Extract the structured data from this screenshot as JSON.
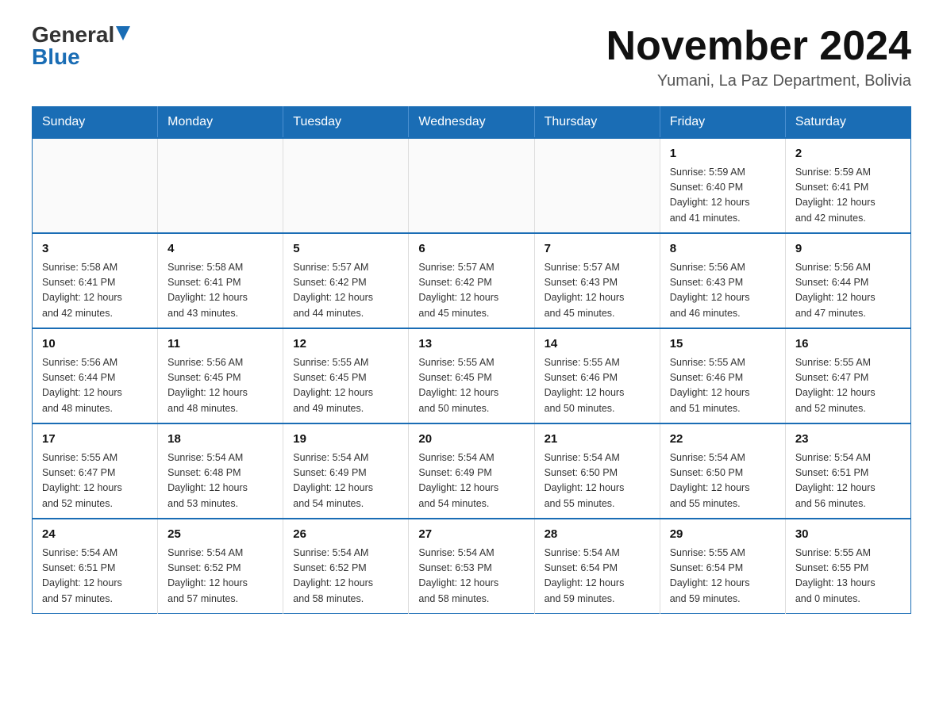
{
  "header": {
    "logo_general": "General",
    "logo_blue": "Blue",
    "month_title": "November 2024",
    "location": "Yumani, La Paz Department, Bolivia"
  },
  "weekdays": [
    "Sunday",
    "Monday",
    "Tuesday",
    "Wednesday",
    "Thursday",
    "Friday",
    "Saturday"
  ],
  "weeks": [
    [
      {
        "day": "",
        "info": ""
      },
      {
        "day": "",
        "info": ""
      },
      {
        "day": "",
        "info": ""
      },
      {
        "day": "",
        "info": ""
      },
      {
        "day": "",
        "info": ""
      },
      {
        "day": "1",
        "info": "Sunrise: 5:59 AM\nSunset: 6:40 PM\nDaylight: 12 hours\nand 41 minutes."
      },
      {
        "day": "2",
        "info": "Sunrise: 5:59 AM\nSunset: 6:41 PM\nDaylight: 12 hours\nand 42 minutes."
      }
    ],
    [
      {
        "day": "3",
        "info": "Sunrise: 5:58 AM\nSunset: 6:41 PM\nDaylight: 12 hours\nand 42 minutes."
      },
      {
        "day": "4",
        "info": "Sunrise: 5:58 AM\nSunset: 6:41 PM\nDaylight: 12 hours\nand 43 minutes."
      },
      {
        "day": "5",
        "info": "Sunrise: 5:57 AM\nSunset: 6:42 PM\nDaylight: 12 hours\nand 44 minutes."
      },
      {
        "day": "6",
        "info": "Sunrise: 5:57 AM\nSunset: 6:42 PM\nDaylight: 12 hours\nand 45 minutes."
      },
      {
        "day": "7",
        "info": "Sunrise: 5:57 AM\nSunset: 6:43 PM\nDaylight: 12 hours\nand 45 minutes."
      },
      {
        "day": "8",
        "info": "Sunrise: 5:56 AM\nSunset: 6:43 PM\nDaylight: 12 hours\nand 46 minutes."
      },
      {
        "day": "9",
        "info": "Sunrise: 5:56 AM\nSunset: 6:44 PM\nDaylight: 12 hours\nand 47 minutes."
      }
    ],
    [
      {
        "day": "10",
        "info": "Sunrise: 5:56 AM\nSunset: 6:44 PM\nDaylight: 12 hours\nand 48 minutes."
      },
      {
        "day": "11",
        "info": "Sunrise: 5:56 AM\nSunset: 6:45 PM\nDaylight: 12 hours\nand 48 minutes."
      },
      {
        "day": "12",
        "info": "Sunrise: 5:55 AM\nSunset: 6:45 PM\nDaylight: 12 hours\nand 49 minutes."
      },
      {
        "day": "13",
        "info": "Sunrise: 5:55 AM\nSunset: 6:45 PM\nDaylight: 12 hours\nand 50 minutes."
      },
      {
        "day": "14",
        "info": "Sunrise: 5:55 AM\nSunset: 6:46 PM\nDaylight: 12 hours\nand 50 minutes."
      },
      {
        "day": "15",
        "info": "Sunrise: 5:55 AM\nSunset: 6:46 PM\nDaylight: 12 hours\nand 51 minutes."
      },
      {
        "day": "16",
        "info": "Sunrise: 5:55 AM\nSunset: 6:47 PM\nDaylight: 12 hours\nand 52 minutes."
      }
    ],
    [
      {
        "day": "17",
        "info": "Sunrise: 5:55 AM\nSunset: 6:47 PM\nDaylight: 12 hours\nand 52 minutes."
      },
      {
        "day": "18",
        "info": "Sunrise: 5:54 AM\nSunset: 6:48 PM\nDaylight: 12 hours\nand 53 minutes."
      },
      {
        "day": "19",
        "info": "Sunrise: 5:54 AM\nSunset: 6:49 PM\nDaylight: 12 hours\nand 54 minutes."
      },
      {
        "day": "20",
        "info": "Sunrise: 5:54 AM\nSunset: 6:49 PM\nDaylight: 12 hours\nand 54 minutes."
      },
      {
        "day": "21",
        "info": "Sunrise: 5:54 AM\nSunset: 6:50 PM\nDaylight: 12 hours\nand 55 minutes."
      },
      {
        "day": "22",
        "info": "Sunrise: 5:54 AM\nSunset: 6:50 PM\nDaylight: 12 hours\nand 55 minutes."
      },
      {
        "day": "23",
        "info": "Sunrise: 5:54 AM\nSunset: 6:51 PM\nDaylight: 12 hours\nand 56 minutes."
      }
    ],
    [
      {
        "day": "24",
        "info": "Sunrise: 5:54 AM\nSunset: 6:51 PM\nDaylight: 12 hours\nand 57 minutes."
      },
      {
        "day": "25",
        "info": "Sunrise: 5:54 AM\nSunset: 6:52 PM\nDaylight: 12 hours\nand 57 minutes."
      },
      {
        "day": "26",
        "info": "Sunrise: 5:54 AM\nSunset: 6:52 PM\nDaylight: 12 hours\nand 58 minutes."
      },
      {
        "day": "27",
        "info": "Sunrise: 5:54 AM\nSunset: 6:53 PM\nDaylight: 12 hours\nand 58 minutes."
      },
      {
        "day": "28",
        "info": "Sunrise: 5:54 AM\nSunset: 6:54 PM\nDaylight: 12 hours\nand 59 minutes."
      },
      {
        "day": "29",
        "info": "Sunrise: 5:55 AM\nSunset: 6:54 PM\nDaylight: 12 hours\nand 59 minutes."
      },
      {
        "day": "30",
        "info": "Sunrise: 5:55 AM\nSunset: 6:55 PM\nDaylight: 13 hours\nand 0 minutes."
      }
    ]
  ]
}
